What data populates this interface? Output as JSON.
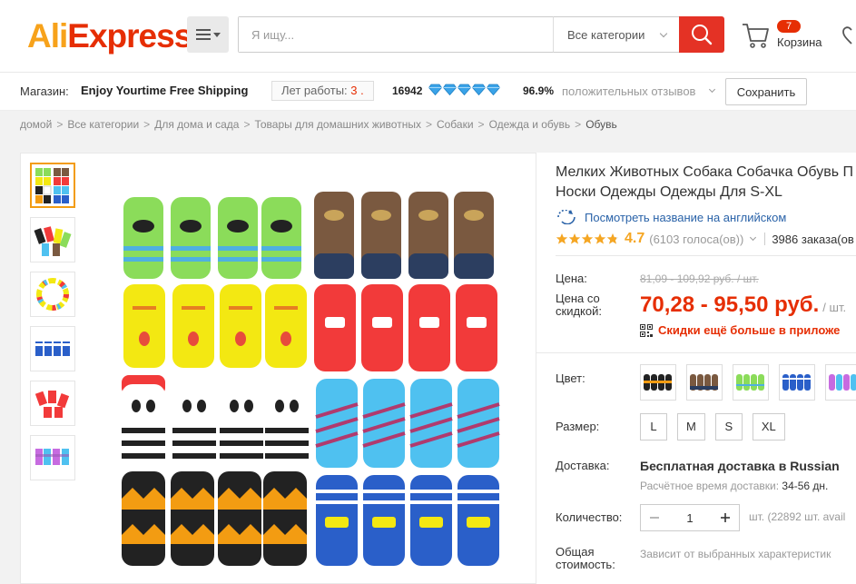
{
  "header": {
    "logo_ali": "Ali",
    "logo_express": "Express",
    "logo_tm": "®",
    "search_placeholder": "Я ищу...",
    "category_select": "Все категории",
    "cart_count": "7",
    "cart_label": "Корзина"
  },
  "store": {
    "label": "Магазин:",
    "name": "Enjoy Yourtime Free Shipping",
    "years_label": "Лет работы:",
    "years_value": "3",
    "rating_count": "16942",
    "diamond_count": 5,
    "positive_pct": "96.9%",
    "positive_label": "положительных отзывов",
    "save_label": "Сохранить"
  },
  "breadcrumb": [
    "домой",
    "Все категории",
    "Для дома и сада",
    "Товары для домашних животных",
    "Собаки",
    "Одежда и обувь"
  ],
  "breadcrumb_current": "Обувь",
  "product": {
    "title_line1": "Мелких Животных Собака Собачка Обувь П",
    "title_line2": "Носки Одежды Одежды Для S-XL",
    "translate_link": "Посмотреть название на английском",
    "rating": "4.7",
    "votes": "(6103 голоса(ов))",
    "orders": "3986 заказа(ов",
    "price_label": "Цена:",
    "old_price": "81,09 - 109,92 руб. / шт.",
    "discount_label": "Цена со скидкой:",
    "new_price": "70,28 - 95,50 руб.",
    "unit": "/ шт.",
    "app_discount": "Скидки ещё больше в приложе",
    "color_label": "Цвет:",
    "size_label": "Размер:",
    "sizes": [
      "L",
      "M",
      "S",
      "XL"
    ],
    "shipping_label": "Доставка:",
    "shipping_main": "Бесплатная доставка в",
    "shipping_dest": "Russian",
    "shipping_time_label": "Расчётное время доставки:",
    "shipping_time_value": "34-56 дн.",
    "qty_label": "Количество:",
    "qty_value": "1",
    "availability": "шт. (22892 шт. avail",
    "total_label": "Общая стоимость:",
    "total_value": "Зависит от выбранных характеристик"
  },
  "colors": {
    "brand_red": "#e62e04",
    "brand_orange": "#f7a21b",
    "link_blue": "#2962a8",
    "star": "#f5a623"
  }
}
